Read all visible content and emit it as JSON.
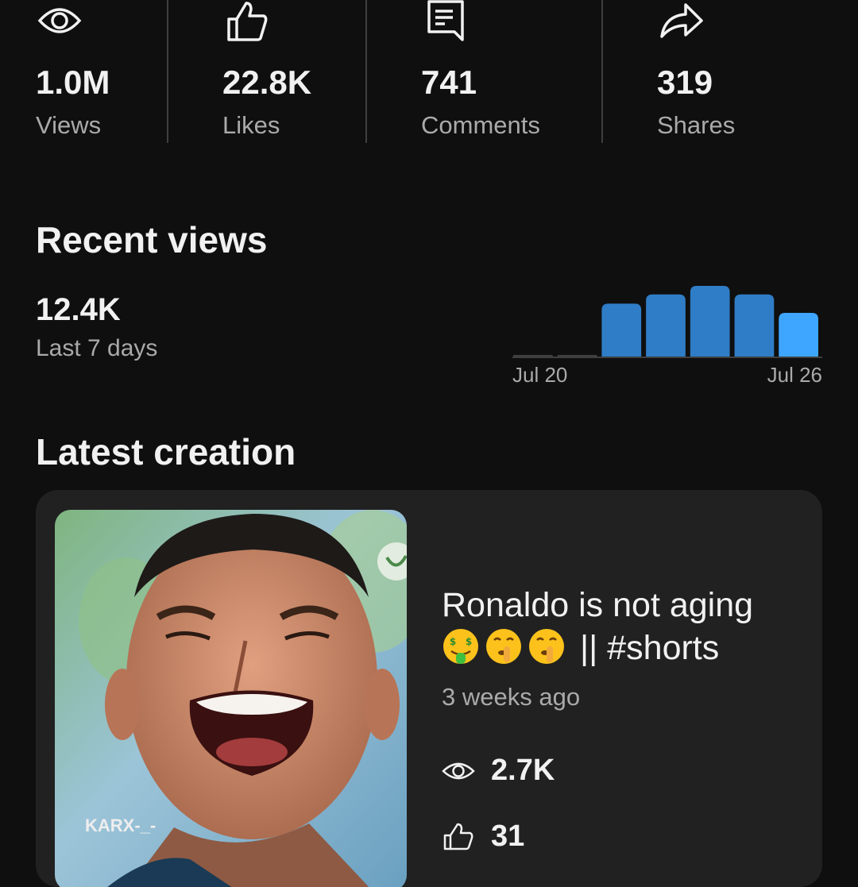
{
  "stats": [
    {
      "icon": "eye-icon",
      "value": "1.0M",
      "label": "Views"
    },
    {
      "icon": "thumbs-up-icon",
      "value": "22.8K",
      "label": "Likes"
    },
    {
      "icon": "comment-icon",
      "value": "741",
      "label": "Comments"
    },
    {
      "icon": "share-icon",
      "value": "319",
      "label": "Shares"
    }
  ],
  "recent": {
    "title": "Recent views",
    "value": "12.4K",
    "period": "Last 7 days"
  },
  "chart_data": {
    "type": "bar",
    "x_start_label": "Jul 20",
    "x_end_label": "Jul 26",
    "values": [
      0,
      0,
      1450,
      1700,
      1930,
      1700,
      1200
    ],
    "highlight_color": "#3ea6ff",
    "bar_color": "#2f7dc6",
    "empty_color": "#3f3f3f"
  },
  "latest": {
    "title": "Latest creation",
    "video": {
      "title_line1": "Ronaldo is not aging",
      "emojis": [
        "money-mouth-face-emoji",
        "shushing-face-emoji",
        "shushing-face-emoji"
      ],
      "title_line2_text": "|| #shorts",
      "time": "3 weeks ago",
      "views": "2.7K",
      "likes": "31",
      "watermark": "KARX-_-"
    }
  }
}
